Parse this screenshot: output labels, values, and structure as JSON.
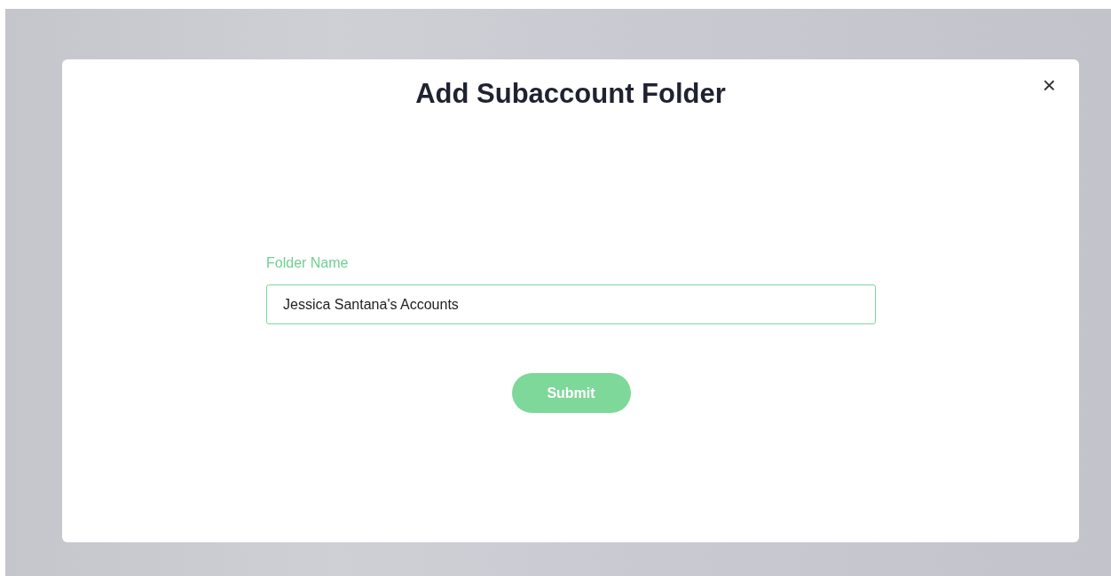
{
  "dialog": {
    "title": "Add Subaccount Folder",
    "close": "×"
  },
  "field": {
    "label": "Folder Name",
    "value": "Jessica Santana's Accounts",
    "focused": true
  },
  "button": {
    "label": "Submit",
    "disabled": false
  }
}
